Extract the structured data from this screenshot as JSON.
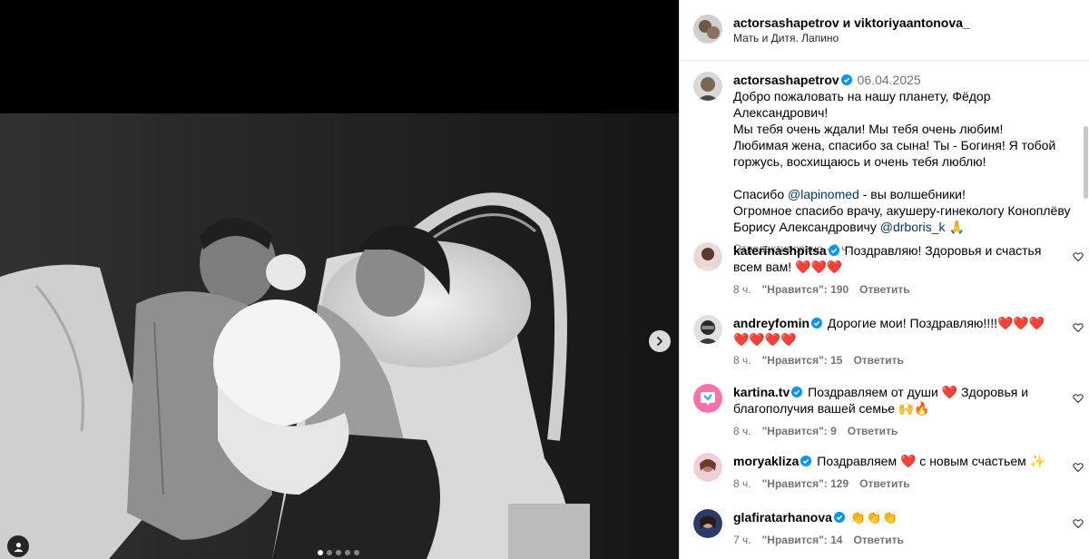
{
  "post": {
    "header_user": "actorsashapetrov и viktoriyaantonova_",
    "location": "Мать и Дитя. Лапино"
  },
  "caption": {
    "username": "actorsashapetrov",
    "date": "06.04.2025",
    "line1": "Добро пожаловать на нашу планету, Фёдор Александрович!",
    "line2": "Мы тебя очень ждали! Мы тебя очень любим!",
    "line3": "Любимая жена, спасибо за сына! Ты - Богиня! Я тобой горжусь, восхищаюсь и очень тебя люблю!",
    "thanks_prefix": "Спасибо ",
    "thanks_mention": "@lapinomed",
    "thanks_suffix": " - вы волшебники!",
    "doctor_text": "Огромное спасибо врачу, акушеру-гинекологу Коноплёву Борису Александровичу ",
    "doctor_mention": "@drboris_k",
    "doctor_emoji": "🙏",
    "edited": "Отредактировано · 5 ч."
  },
  "comments": [
    {
      "username": "katerinashpitsa",
      "text": "Поздравляю! Здоровья и счастья всем вам! ❤️❤️❤️",
      "time": "8 ч.",
      "likes": "\"Нравится\": 190",
      "reply": "Ответить"
    },
    {
      "username": "andreyfomin",
      "text": "Дорогие мои! Поздравляю!!!!❤️❤️❤️❤️❤️❤️❤️",
      "time": "8 ч.",
      "likes": "\"Нравится\": 15",
      "reply": "Ответить"
    },
    {
      "username": "kartina.tv",
      "text": "Поздравляем от души ❤️ Здоровья и благополучия вашей семье 🙌🔥",
      "time": "8 ч.",
      "likes": "\"Нравится\": 9",
      "reply": "Ответить"
    },
    {
      "username": "moryakliza",
      "text": "Поздравляем ❤️ с новым счастьем ✨",
      "time": "8 ч.",
      "likes": "\"Нравится\": 129",
      "reply": "Ответить"
    },
    {
      "username": "glafiratarhanova",
      "text": "👏👏👏",
      "time": "7 ч.",
      "likes": "\"Нравится\": 14",
      "reply": "Ответить"
    }
  ],
  "icons": {
    "verified": "verified-badge-icon",
    "like": "heart-outline-icon",
    "next": "chevron-right-icon",
    "tag": "person-tag-icon"
  },
  "colors": {
    "verified_blue": "#0095f6",
    "link": "#00376b",
    "muted": "#737373"
  }
}
